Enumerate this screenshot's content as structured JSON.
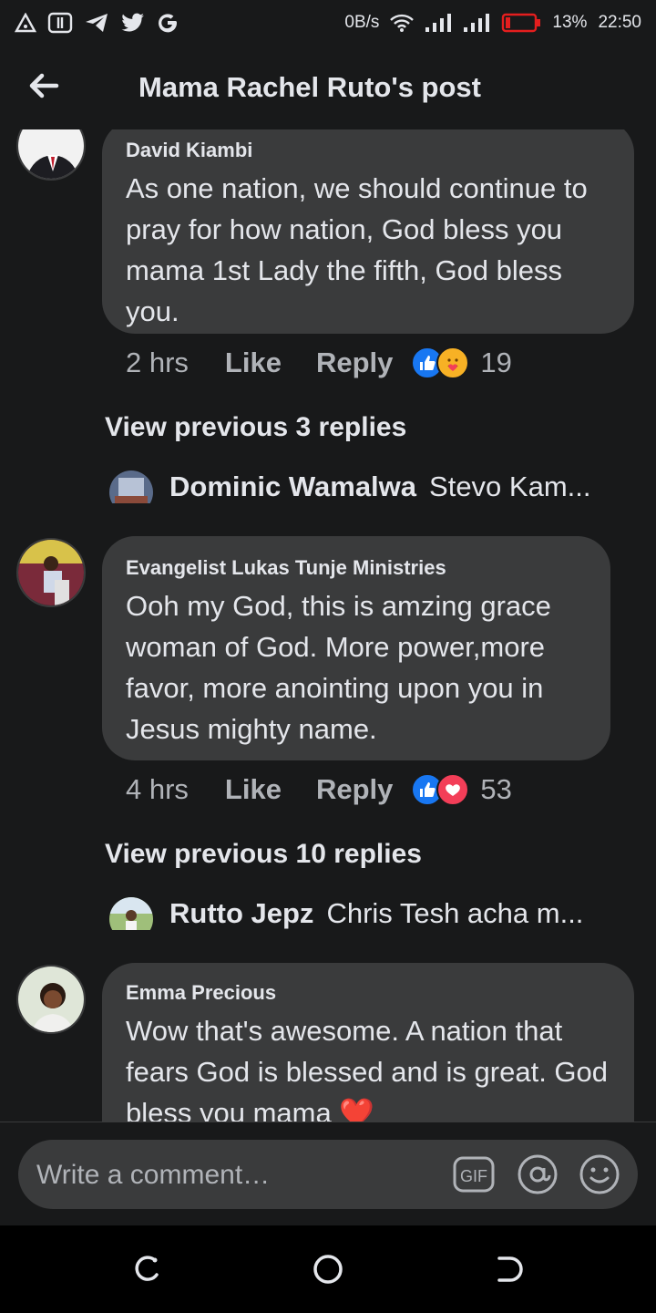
{
  "status_bar": {
    "net_speed": "0B/s",
    "battery": "13%",
    "time": "22:50"
  },
  "header": {
    "title": "Mama Rachel Ruto's post",
    "back_icon": "arrow-left-icon"
  },
  "comments": [
    {
      "author": "David Kiambi",
      "text": "As one nation, we should  continue to  pray for how nation, God bless you  mama 1st Lady  the  fifth,  God bless you.",
      "time": "2 hrs",
      "like_label": "Like",
      "reply_label": "Reply",
      "reaction_count": "19",
      "reactions": [
        "like",
        "care"
      ]
    },
    {
      "author": "Evangelist  Lukas Tunje Ministries",
      "text": "Ooh my God, this is amzing grace woman of God. More power,more favor, more anointing upon you in Jesus mighty name.",
      "time": "4 hrs",
      "like_label": "Like",
      "reply_label": "Reply",
      "reaction_count": "53",
      "reactions": [
        "like",
        "love"
      ]
    },
    {
      "author": "Emma Precious",
      "text": "Wow that's awesome. A nation that fears God is blessed and is great. God bless you mama ❤️"
    }
  ],
  "view_previous": [
    {
      "label": "View previous 3 replies"
    },
    {
      "label": "View previous 10 replies"
    }
  ],
  "reply_previews": [
    {
      "name": "Dominic Wamalwa",
      "text": "Stevo Kam..."
    },
    {
      "name": "Rutto Jepz",
      "text": "Chris Tesh acha m..."
    }
  ],
  "composer": {
    "placeholder": "Write a comment…",
    "gif_label": "GIF",
    "mention_icon": "at-icon",
    "emoji_icon": "smiley-icon"
  },
  "colors": {
    "background": "#18191a",
    "bubble": "#3a3b3c",
    "text": "#e4e6eb",
    "secondary_text": "#b0b3b8",
    "like_blue": "#1877f2",
    "love_red": "#f33e58",
    "battery_red": "#e41e1e"
  }
}
